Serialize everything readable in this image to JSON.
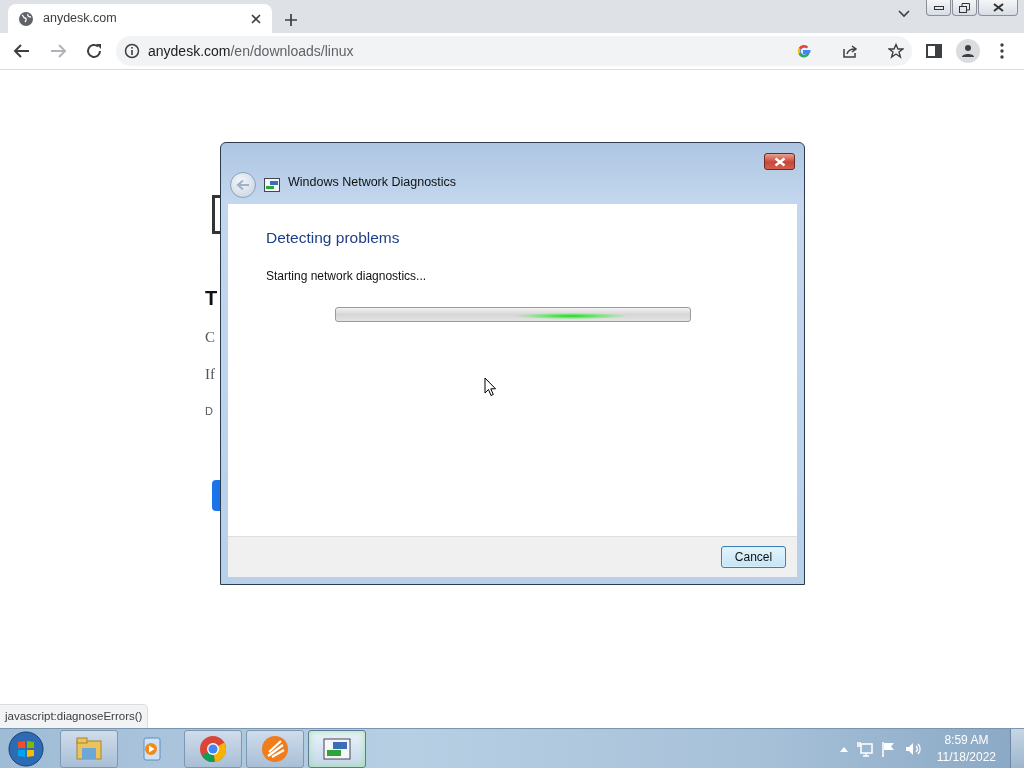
{
  "browser": {
    "tab": {
      "title": "anydesk.com"
    },
    "address": {
      "host": "anydesk.com",
      "path": "/en/downloads/linux"
    },
    "status_url": "javascript:diagnoseErrors()"
  },
  "page_fragments": [
    {
      "kind": "heading",
      "text": "T"
    },
    {
      "kind": "text",
      "text": "C"
    },
    {
      "kind": "text",
      "text": "If"
    },
    {
      "kind": "small",
      "text": "D"
    }
  ],
  "dialog": {
    "title": "Windows Network Diagnostics",
    "heading": "Detecting problems",
    "status": "Starting network diagnostics...",
    "progress": {
      "indeterminate": true
    },
    "buttons": [
      "Cancel"
    ]
  },
  "taskbar": {
    "apps": [
      {
        "kind": "explorer",
        "selected": false
      },
      {
        "kind": "media",
        "selected": false
      },
      {
        "kind": "chrome",
        "selected": false
      },
      {
        "kind": "circle-logo",
        "selected": false
      },
      {
        "kind": "network",
        "selected": true
      }
    ],
    "clock": {
      "time": "8:59 AM",
      "date": "11/18/2022"
    }
  }
}
